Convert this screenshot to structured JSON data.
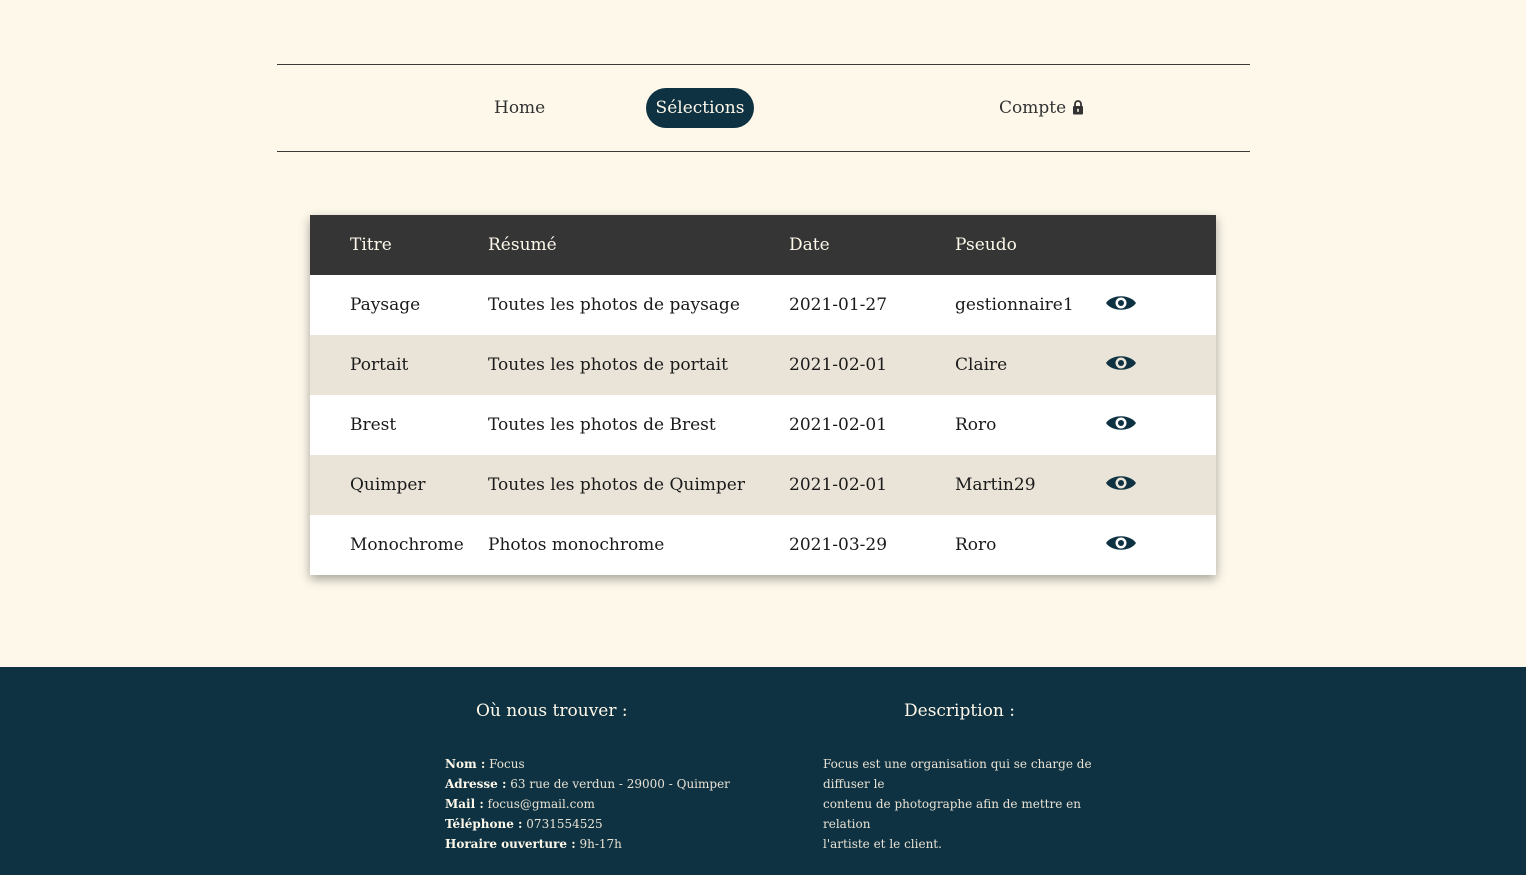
{
  "nav": {
    "home": "Home",
    "selections": "Sélections",
    "account": "Compte"
  },
  "table": {
    "headers": [
      "Titre",
      "Résumé",
      "Date",
      "Pseudo"
    ],
    "rows": [
      {
        "titre": "Paysage",
        "resume": "Toutes les photos de paysage",
        "date": "2021-01-27",
        "pseudo": "gestionnaire1",
        "icon": "eye-icon"
      },
      {
        "titre": "Portait",
        "resume": "Toutes les photos de portait",
        "date": "2021-02-01",
        "pseudo": "Claire",
        "icon": "eye-icon"
      },
      {
        "titre": "Brest",
        "resume": "Toutes les photos de Brest",
        "date": "2021-02-01",
        "pseudo": "Roro",
        "icon": "eye-icon"
      },
      {
        "titre": "Quimper",
        "resume": "Toutes les photos de Quimper",
        "date": "2021-02-01",
        "pseudo": "Martin29",
        "icon": "eye-icon"
      },
      {
        "titre": "Monochrome",
        "resume": "Photos monochrome",
        "date": "2021-03-29",
        "pseudo": "Roro",
        "icon": "eye-icon"
      }
    ]
  },
  "footer": {
    "contact_title": "Où nous trouver :",
    "description_title": "Description :",
    "contact": [
      {
        "label": "Nom :",
        "value": "Focus"
      },
      {
        "label": "Adresse :",
        "value": "63 rue de verdun - 29000 - Quimper"
      },
      {
        "label": "Mail :",
        "value": "focus@gmail.com"
      },
      {
        "label": "Téléphone :",
        "value": "0731554525"
      },
      {
        "label": "Horaire ouverture :",
        "value": "9h-17h"
      }
    ],
    "description_lines": [
      "Focus est une organisation qui se charge de diffuser le",
      "contenu de photographe afin de mettre en relation",
      "l'artiste et le client."
    ]
  },
  "colors": {
    "background": "#fdf8ea",
    "accent": "#0f3242",
    "table_header": "#353535",
    "row_alt": "#eae4d8"
  }
}
